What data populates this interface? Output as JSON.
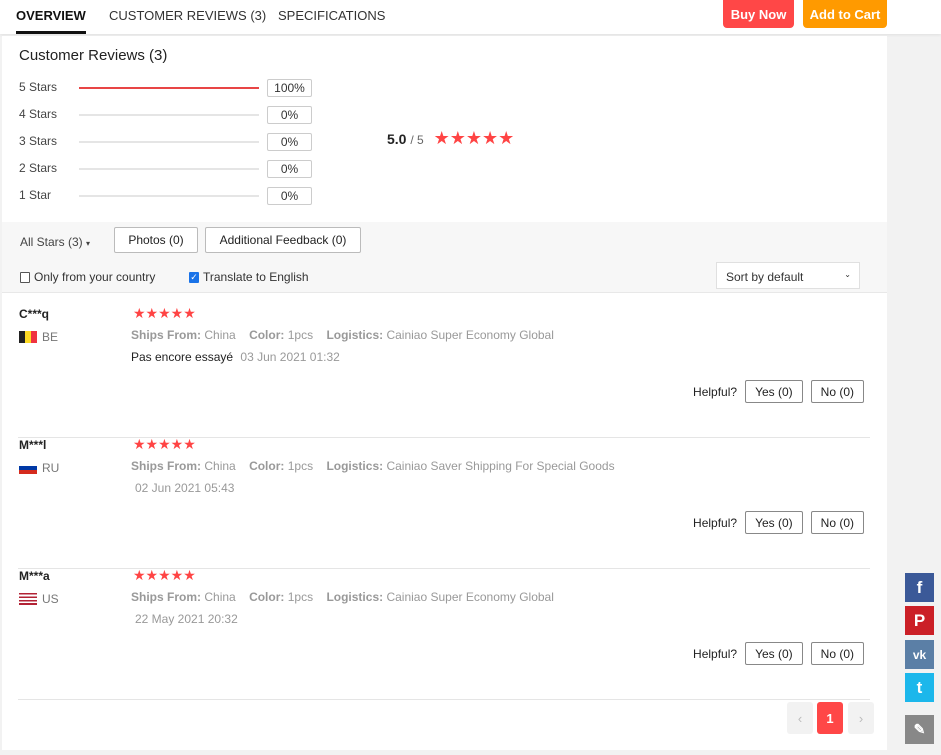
{
  "tabs": [
    {
      "label": "OVERVIEW"
    },
    {
      "label": "CUSTOMER REVIEWS (3)"
    },
    {
      "label": "SPECIFICATIONS"
    }
  ],
  "actions": {
    "buy_now": "Buy Now",
    "add_to_cart": "Add to Cart"
  },
  "colors": {
    "buy_now": "#ff4747",
    "add_to_cart": "#ff9a00",
    "star": "#ff4747"
  },
  "summary": {
    "title": "Customer Reviews (3)",
    "average": "5.0",
    "max": "/ 5",
    "stars": "★★★★★",
    "breakdown": [
      {
        "label": "5 Stars",
        "pct": "100%",
        "value": 100
      },
      {
        "label": "4 Stars",
        "pct": "0%",
        "value": 0
      },
      {
        "label": "3 Stars",
        "pct": "0%",
        "value": 0
      },
      {
        "label": "2 Stars",
        "pct": "0%",
        "value": 0
      },
      {
        "label": "1 Star",
        "pct": "0%",
        "value": 0
      }
    ]
  },
  "filters": {
    "all_stars": "All Stars (3)",
    "photos": "Photos (0)",
    "additional": "Additional Feedback (0)",
    "only_country": "Only from your country",
    "translate": "Translate to English",
    "translate_checked": true,
    "only_country_checked": false,
    "sort": "Sort by default"
  },
  "labels": {
    "ships_from": "Ships From:",
    "color": "Color:",
    "logistics": "Logistics:",
    "helpful": "Helpful?"
  },
  "reviews": [
    {
      "user": "C***q",
      "country": "BE",
      "stars": "★★★★★",
      "ships_from": "China",
      "color": "1pcs",
      "logistics": "Cainiao Super Economy Global",
      "text": "Pas encore essayé",
      "date": "03 Jun 2021 01:32",
      "yes": "Yes (0)",
      "no": "No (0)"
    },
    {
      "user": "M***l",
      "country": "RU",
      "stars": "★★★★★",
      "ships_from": "China",
      "color": "1pcs",
      "logistics": "Cainiao Saver Shipping For Special Goods",
      "text": "",
      "date": "02 Jun 2021 05:43",
      "yes": "Yes (0)",
      "no": "No (0)"
    },
    {
      "user": "M***a",
      "country": "US",
      "stars": "★★★★★",
      "ships_from": "China",
      "color": "1pcs",
      "logistics": "Cainiao Super Economy Global",
      "text": "",
      "date": "22 May 2021 20:32",
      "yes": "Yes (0)",
      "no": "No (0)"
    }
  ],
  "pagination": {
    "prev": "‹",
    "current": "1",
    "next": "›"
  },
  "social": {
    "facebook": "f",
    "pinterest": "P",
    "vk": "vk",
    "twitter": "t",
    "edit": "✎"
  }
}
